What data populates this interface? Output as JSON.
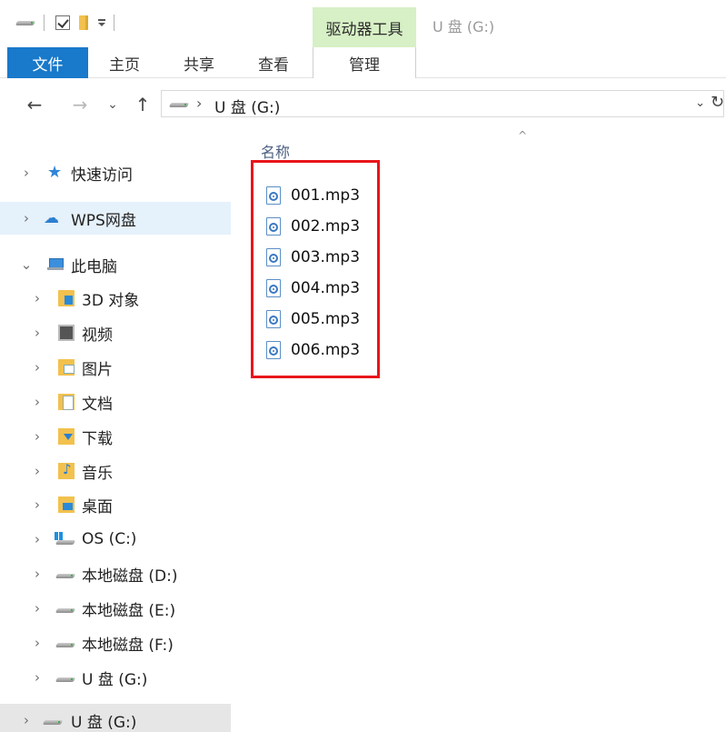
{
  "titlebar": {
    "context_tab_group": "驱动器工具",
    "window_title": "U 盘 (G:)"
  },
  "ribbon": {
    "tabs": [
      {
        "label": "文件",
        "active": true
      },
      {
        "label": "主页"
      },
      {
        "label": "共享"
      },
      {
        "label": "查看"
      },
      {
        "label": "管理"
      }
    ]
  },
  "navigation": {
    "back_icon": "←",
    "forward_icon": "→",
    "recent_icon": "⌄",
    "up_icon": "↑",
    "address": {
      "separator": "›",
      "path": "U 盘 (G:)",
      "dropdown_icon": "⌄",
      "refresh_icon": "↻"
    }
  },
  "navpane": {
    "chevron_collapsed": "›",
    "chevron_expanded": "⌄",
    "quick_access": "快速访问",
    "wps_drive": "WPS网盘",
    "this_pc": "此电脑",
    "pc_items": [
      {
        "label": "3D 对象",
        "icon": "folder-3d-objects-icon"
      },
      {
        "label": "视频",
        "icon": "folder-videos-icon"
      },
      {
        "label": "图片",
        "icon": "folder-pictures-icon"
      },
      {
        "label": "文档",
        "icon": "folder-documents-icon"
      },
      {
        "label": "下载",
        "icon": "folder-downloads-icon"
      },
      {
        "label": "音乐",
        "icon": "folder-music-icon"
      },
      {
        "label": "桌面",
        "icon": "folder-desktop-icon"
      },
      {
        "label": "OS (C:)",
        "icon": "os-drive-icon"
      },
      {
        "label": "本地磁盘 (D:)",
        "icon": "drive-icon"
      },
      {
        "label": "本地磁盘 (E:)",
        "icon": "drive-icon"
      },
      {
        "label": "本地磁盘 (F:)",
        "icon": "drive-icon"
      },
      {
        "label": "U 盘 (G:)",
        "icon": "usb-drive-icon"
      }
    ],
    "bottom_item": "U 盘 (G:)"
  },
  "content": {
    "sort_indicator": "^",
    "column_name": "名称",
    "files": [
      "001.mp3",
      "002.mp3",
      "003.mp3",
      "004.mp3",
      "005.mp3",
      "006.mp3"
    ]
  },
  "colors": {
    "file_tab_bg": "#1979ca",
    "context_tab_bg": "#d7f0c5",
    "selection_bg": "#e5f1fb",
    "highlight_border": "#e8151b"
  }
}
